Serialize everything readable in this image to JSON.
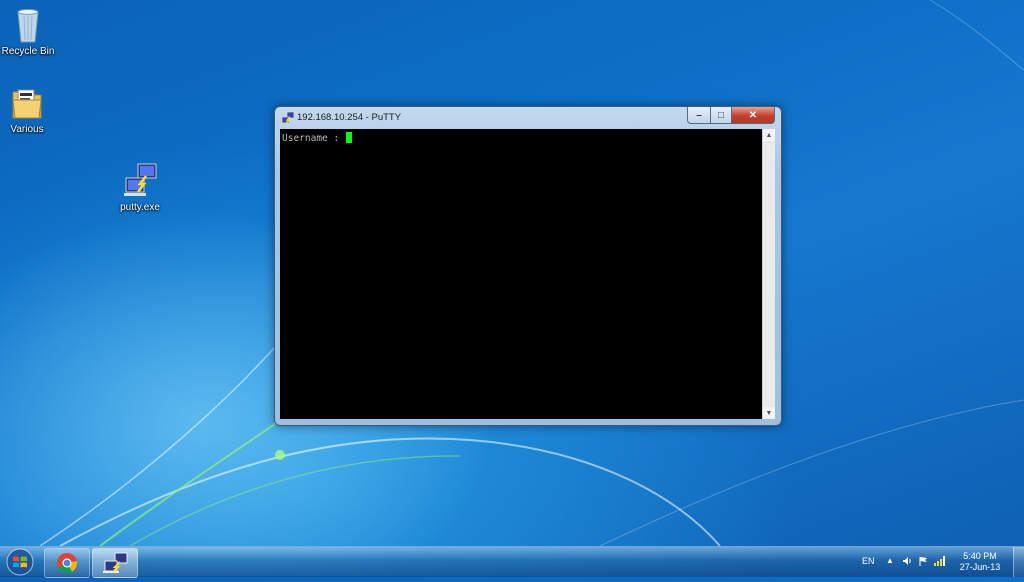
{
  "desktop": {
    "icons": [
      {
        "label": "Recycle Bin"
      },
      {
        "label": "Various"
      },
      {
        "label": "putty.exe"
      }
    ]
  },
  "window": {
    "title": "192.168.10.254 - PuTTY",
    "terminal_prompt": "Username : "
  },
  "taskbar": {
    "pinned": [
      "chrome-icon",
      "putty-icon"
    ],
    "language": "EN",
    "time": "5:40 PM",
    "date": "27-Jun-13"
  },
  "colors": {
    "cursor": "#00ff00",
    "terminal_bg": "#000000",
    "close_button": "#c4402c"
  }
}
